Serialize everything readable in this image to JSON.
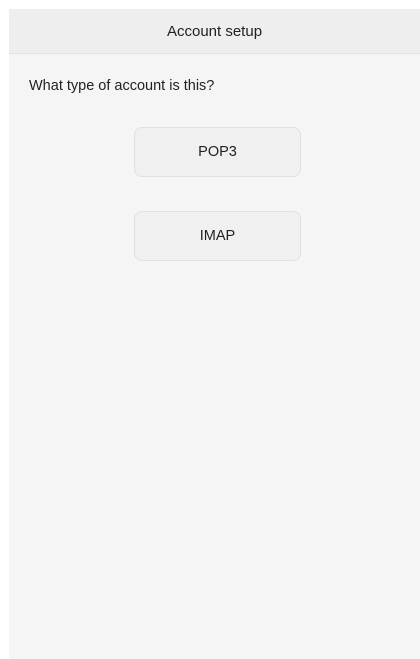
{
  "header": {
    "title": "Account setup"
  },
  "prompt": {
    "question": "What type of account is this?"
  },
  "account_types": [
    {
      "label": "POP3"
    },
    {
      "label": "IMAP"
    }
  ],
  "colors": {
    "background": "#f5f5f5",
    "header_background": "#eeeeee",
    "button_background": "#f0f0f0",
    "text": "#222222"
  }
}
